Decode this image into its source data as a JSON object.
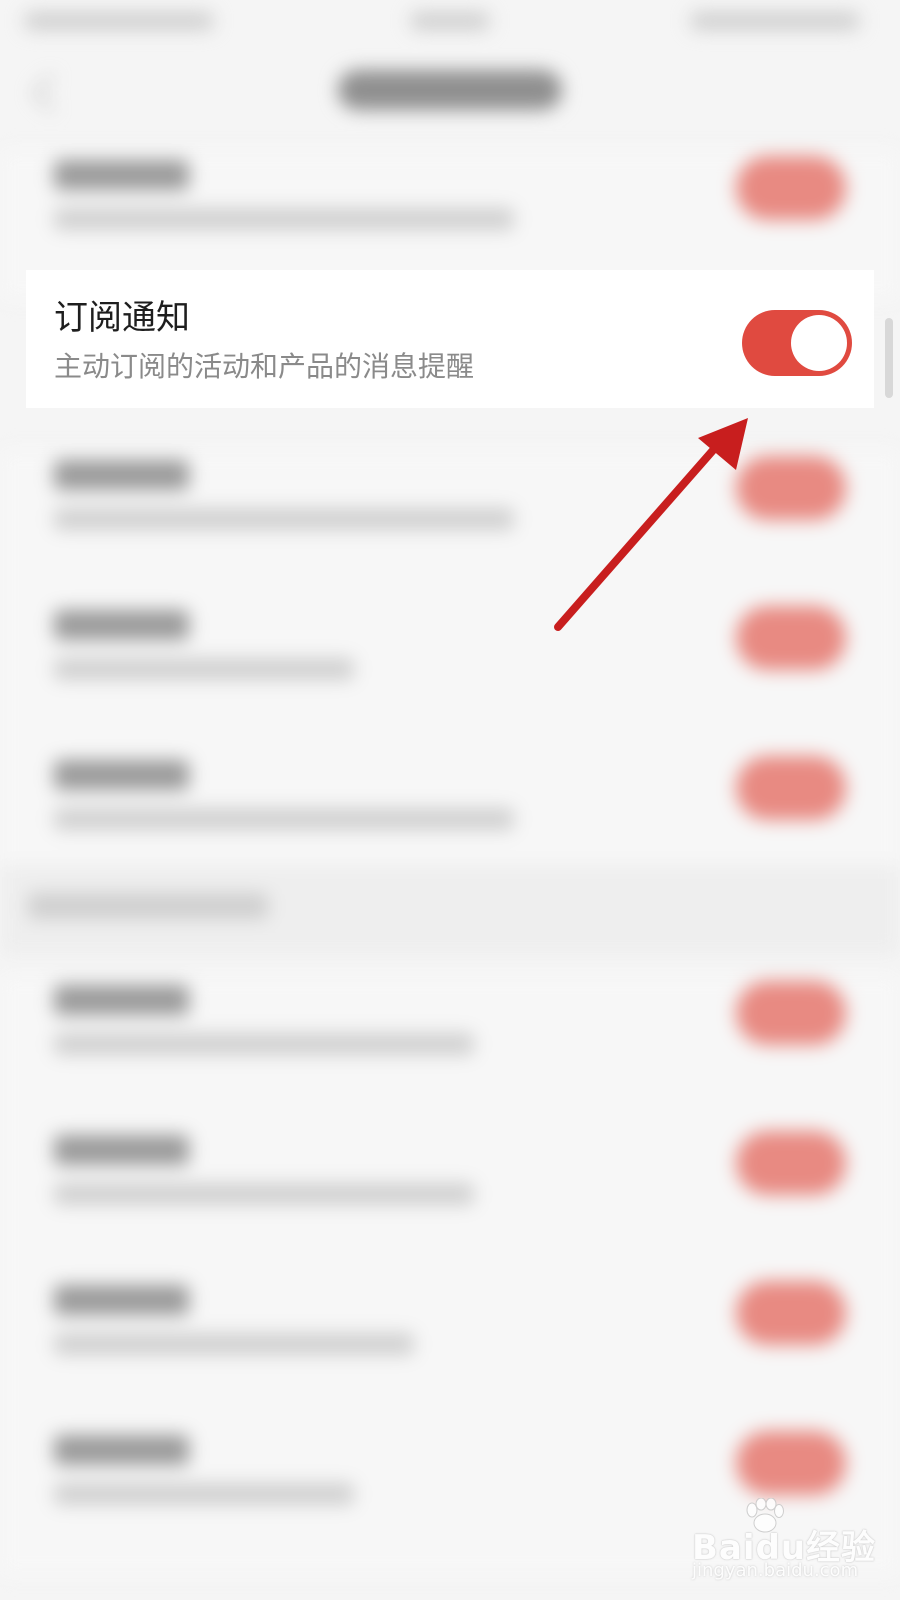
{
  "setting": {
    "title": "订阅通知",
    "description": "主动订阅的活动和产品的消息提醒",
    "enabled": true
  },
  "colors": {
    "toggle_on": "#e04a40",
    "annotation_arrow": "#c81e1e",
    "background": "#f5f5f5"
  },
  "watermark": {
    "brand": "Baidu经验",
    "url": "jingyan.baidu.com"
  }
}
